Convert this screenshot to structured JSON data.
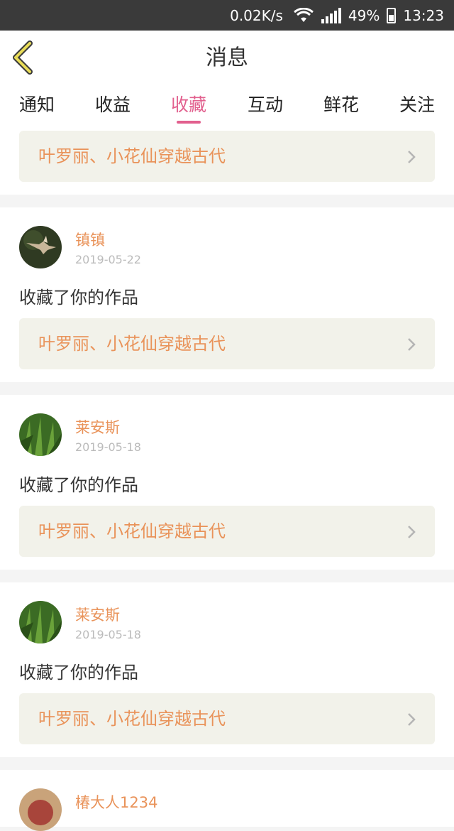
{
  "status_bar": {
    "speed": "0.02K/s",
    "network": "3G",
    "battery": "49%",
    "time": "13:23"
  },
  "header": {
    "title": "消息",
    "back_icon": "chevron-left-icon",
    "back_color": "#e8dc58"
  },
  "tabs": [
    {
      "label": "通知"
    },
    {
      "label": "收益"
    },
    {
      "label": "收藏",
      "active": true
    },
    {
      "label": "互动"
    },
    {
      "label": "鲜花"
    },
    {
      "label": "关注"
    }
  ],
  "colors": {
    "accent": "#e2608e",
    "orange": "#e9935a",
    "work_bg": "#f2f2ea"
  },
  "first_work": {
    "title": "叶罗丽、小花仙穿越古代"
  },
  "messages": [
    {
      "username": "镇镇",
      "date": "2019-05-22",
      "text": "收藏了你的作品",
      "work_title": "叶罗丽、小花仙穿越古代",
      "avatar": "hummingbird"
    },
    {
      "username": "莱安斯",
      "date": "2019-05-18",
      "text": "收藏了你的作品",
      "work_title": "叶罗丽、小花仙穿越古代",
      "avatar": "grass"
    },
    {
      "username": "莱安斯",
      "date": "2019-05-18",
      "text": "收藏了你的作品",
      "work_title": "叶罗丽、小花仙穿越古代",
      "avatar": "grass"
    }
  ],
  "last_message": {
    "username": "椿大人1234"
  }
}
